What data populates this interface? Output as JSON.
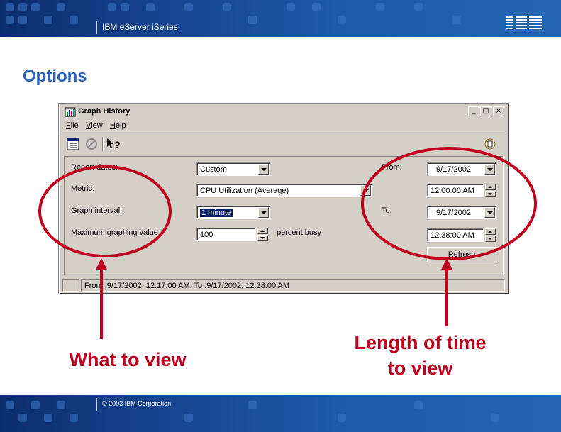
{
  "header": {
    "product": "IBM eServer iSeries",
    "logo": "IBM"
  },
  "slide_title": "Options",
  "window": {
    "title": "Graph History",
    "controls": {
      "minimize": "_",
      "maximize": "□",
      "close": "×"
    },
    "menu": [
      {
        "label": "File",
        "mnemonic": "F",
        "rest": "ile"
      },
      {
        "label": "View",
        "mnemonic": "V",
        "rest": "iew"
      },
      {
        "label": "Help",
        "mnemonic": "H",
        "rest": "elp"
      }
    ],
    "toolbar": [
      "properties-icon",
      "stop-icon",
      "whats-this-help-icon"
    ],
    "form": {
      "report_dates": {
        "label": "Report dates:",
        "value": "Custom"
      },
      "metric": {
        "label": "Metric:",
        "value": "CPU Utilization (Average)"
      },
      "graph_interval": {
        "label": "Graph interval:",
        "value": "1 minute"
      },
      "max_value": {
        "label": "Maximum graphing value:",
        "value": "100",
        "unit": "percent busy"
      },
      "from": {
        "label": "From:",
        "date": "9/17/2002",
        "time": "12:00:00 AM"
      },
      "to": {
        "label": "To:",
        "date": "9/17/2002",
        "time": "12:38:00 AM"
      },
      "refresh_label": "Refresh"
    },
    "status": "From :9/17/2002, 12:17:00 AM; To :9/17/2002, 12:38:00 AM"
  },
  "annotations": {
    "left": "What to view",
    "right_line1": "Length of time",
    "right_line2": "to view",
    "color": "#c0001f"
  },
  "footer": {
    "copyright": "© 2003 IBM Corporation"
  }
}
